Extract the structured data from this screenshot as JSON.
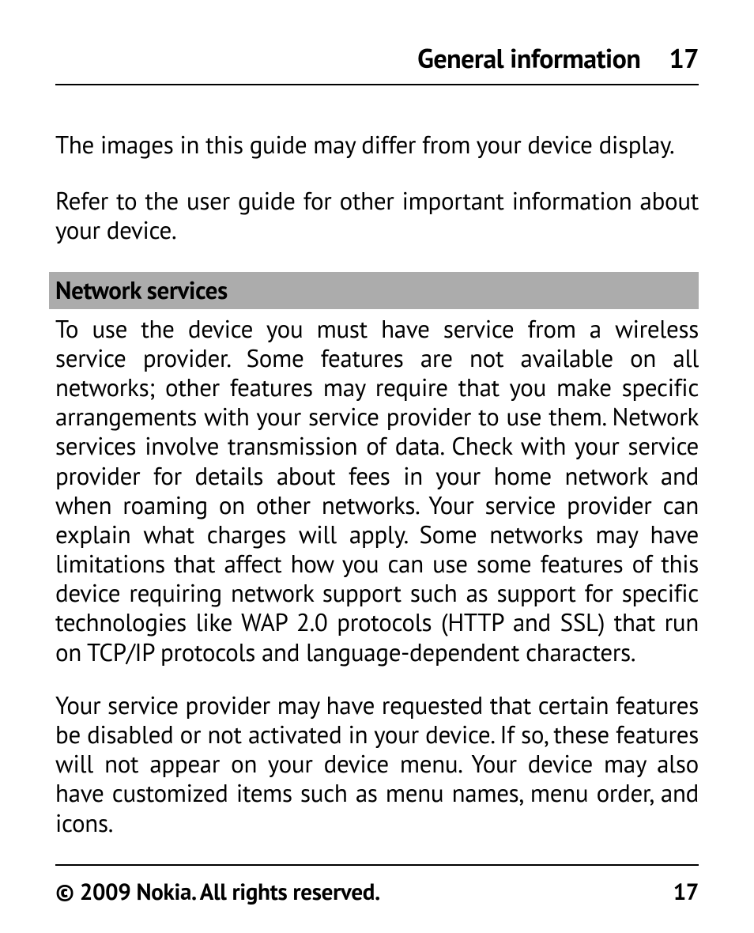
{
  "header": {
    "title": "General information",
    "page": "17"
  },
  "body": {
    "para1": "The images in this guide may differ from your device display.",
    "para2": "Refer to the user guide for other important information about your device.",
    "section_heading": "Network services",
    "para3": "To use the device you must have service from a wireless service provider. Some features are not available on all networks; other features may require that you make specific arrangements with your service provider to use them. Network services involve transmission of data. Check with your service provider for details about fees in your home network and when roaming on other networks. Your service provider can explain what charges will apply. Some networks may have limitations that affect how you can use some features of this device requiring network support such as support for specific technologies like WAP 2.0 protocols (HTTP and SSL) that run on TCP/IP protocols and language-dependent characters.",
    "para4": "Your service provider may have requested that certain features be disabled or not activated in your device. If so, these features will not appear on your device menu. Your device may also have customized items such as menu names, menu order, and icons."
  },
  "footer": {
    "copyright": "© 2009 Nokia. All rights reserved.",
    "page": "17"
  }
}
